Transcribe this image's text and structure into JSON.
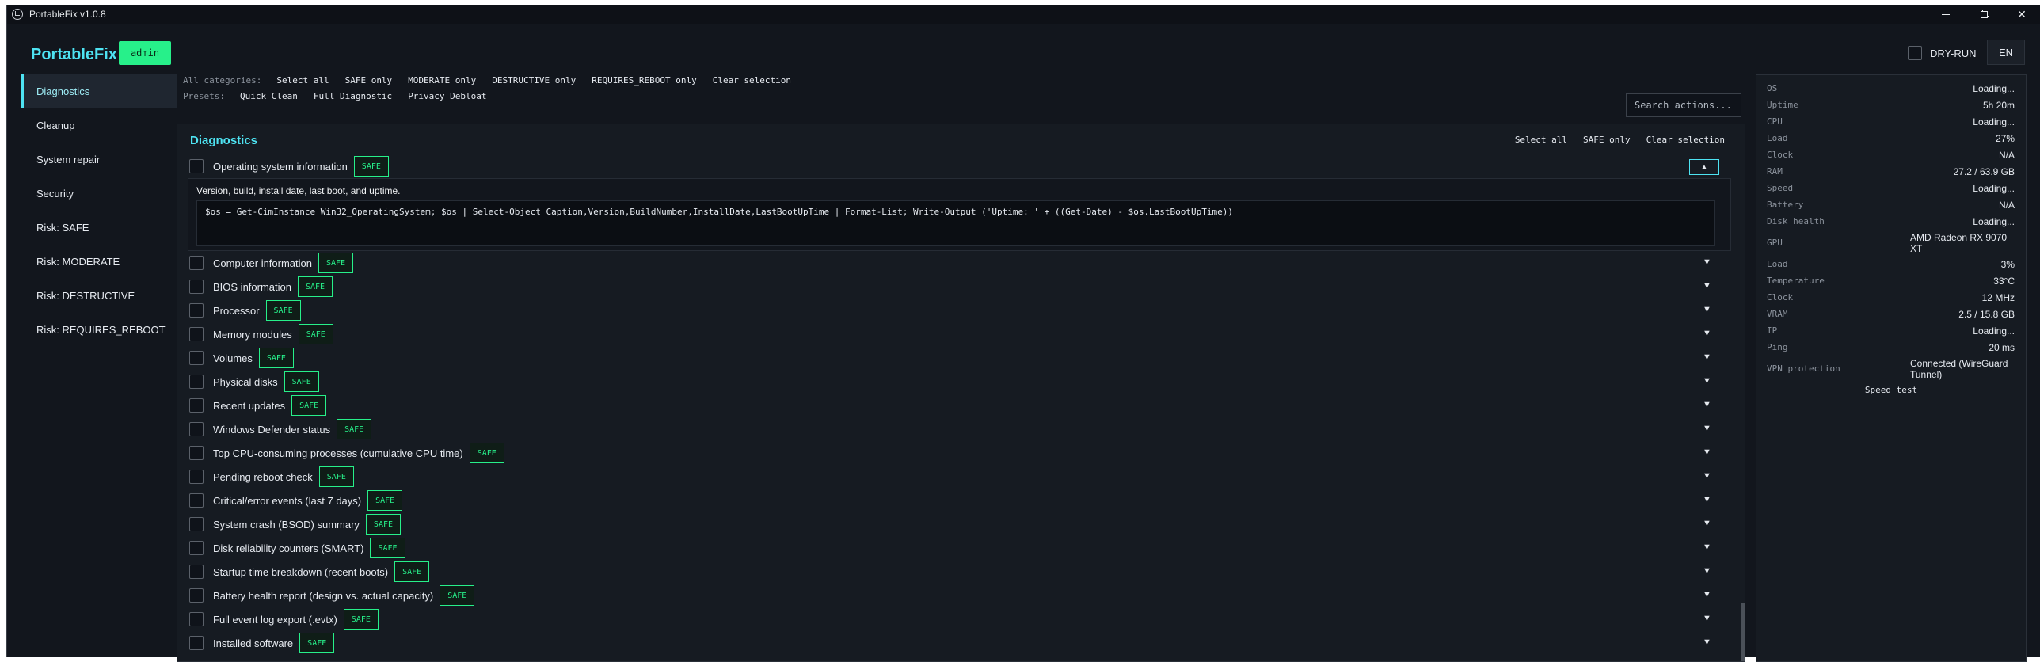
{
  "window": {
    "title": "PortableFix v1.0.8"
  },
  "header": {
    "brand": "PortableFix",
    "role_badge": "admin",
    "dry_run_label": "DRY-RUN",
    "language": "EN"
  },
  "sidebar": {
    "items": [
      {
        "label": "Diagnostics",
        "active": true
      },
      {
        "label": "Cleanup"
      },
      {
        "label": "System repair"
      },
      {
        "label": "Security"
      },
      {
        "label": "Risk: SAFE"
      },
      {
        "label": "Risk: MODERATE"
      },
      {
        "label": "Risk: DESTRUCTIVE"
      },
      {
        "label": "Risk: REQUIRES_REBOOT"
      }
    ]
  },
  "toolbar": {
    "categories_label": "All categories:",
    "category_buttons": [
      "Select all",
      "SAFE only",
      "MODERATE only",
      "DESTRUCTIVE only",
      "REQUIRES_REBOOT only",
      "Clear selection"
    ],
    "presets_label": "Presets:",
    "preset_buttons": [
      "Quick Clean",
      "Full Diagnostic",
      "Privacy Debloat"
    ],
    "search_placeholder": "Search actions..."
  },
  "panel": {
    "title": "Diagnostics",
    "actions": [
      "Select all",
      "SAFE only",
      "Clear selection"
    ],
    "expanded": {
      "label": "Operating system information",
      "badge": "SAFE",
      "collapse_icon": "▲",
      "description": "Version, build, install date, last boot, and uptime.",
      "code": "$os = Get-CimInstance Win32_OperatingSystem; $os | Select-Object Caption,Version,BuildNumber,InstallDate,LastBootUpTime | Format-List; Write-Output ('Uptime: ' + ((Get-Date) - $os.LastBootUpTime))"
    },
    "expand_icon": "▼",
    "rows": [
      {
        "label": "Computer information",
        "badge": "SAFE"
      },
      {
        "label": "BIOS information",
        "badge": "SAFE"
      },
      {
        "label": "Processor",
        "badge": "SAFE"
      },
      {
        "label": "Memory modules",
        "badge": "SAFE"
      },
      {
        "label": "Volumes",
        "badge": "SAFE"
      },
      {
        "label": "Physical disks",
        "badge": "SAFE"
      },
      {
        "label": "Recent updates",
        "badge": "SAFE"
      },
      {
        "label": "Windows Defender status",
        "badge": "SAFE"
      },
      {
        "label": "Top CPU-consuming processes (cumulative CPU time)",
        "badge": "SAFE"
      },
      {
        "label": "Pending reboot check",
        "badge": "SAFE"
      },
      {
        "label": "Critical/error events (last 7 days)",
        "badge": "SAFE"
      },
      {
        "label": "System crash (BSOD) summary",
        "badge": "SAFE"
      },
      {
        "label": "Disk reliability counters (SMART)",
        "badge": "SAFE"
      },
      {
        "label": "Startup time breakdown (recent boots)",
        "badge": "SAFE"
      },
      {
        "label": "Battery health report (design vs. actual capacity)",
        "badge": "SAFE"
      },
      {
        "label": "Full event log export (.evtx)",
        "badge": "SAFE"
      },
      {
        "label": "Installed software",
        "badge": "SAFE"
      }
    ]
  },
  "system_info": {
    "rows": [
      {
        "key": "OS",
        "value": "Loading..."
      },
      {
        "key": "Uptime",
        "value": "5h 20m"
      },
      {
        "key": "CPU",
        "value": "Loading..."
      },
      {
        "key": "Load",
        "value": "27%"
      },
      {
        "key": "Clock",
        "value": "N/A"
      },
      {
        "key": "RAM",
        "value": "27.2 / 63.9 GB"
      },
      {
        "key": "Speed",
        "value": "Loading..."
      },
      {
        "key": "Battery",
        "value": "N/A"
      },
      {
        "key": "Disk health",
        "value": "Loading..."
      },
      {
        "key": "GPU",
        "value": "AMD Radeon RX 9070 XT",
        "multiline": true
      },
      {
        "key": "Load",
        "value": "3%"
      },
      {
        "key": "Temperature",
        "value": "33°C"
      },
      {
        "key": "Clock",
        "value": "12 MHz"
      },
      {
        "key": "VRAM",
        "value": "2.5 / 15.8 GB"
      },
      {
        "key": "IP",
        "value": "Loading..."
      },
      {
        "key": "Ping",
        "value": "20 ms"
      },
      {
        "key": "VPN protection",
        "value": "Connected (WireGuard Tunnel)",
        "multiline": true
      }
    ],
    "speed_test_label": "Speed test"
  },
  "colors": {
    "accent": "#4ee3f2",
    "safe": "#27f08a",
    "background": "#12161d"
  }
}
